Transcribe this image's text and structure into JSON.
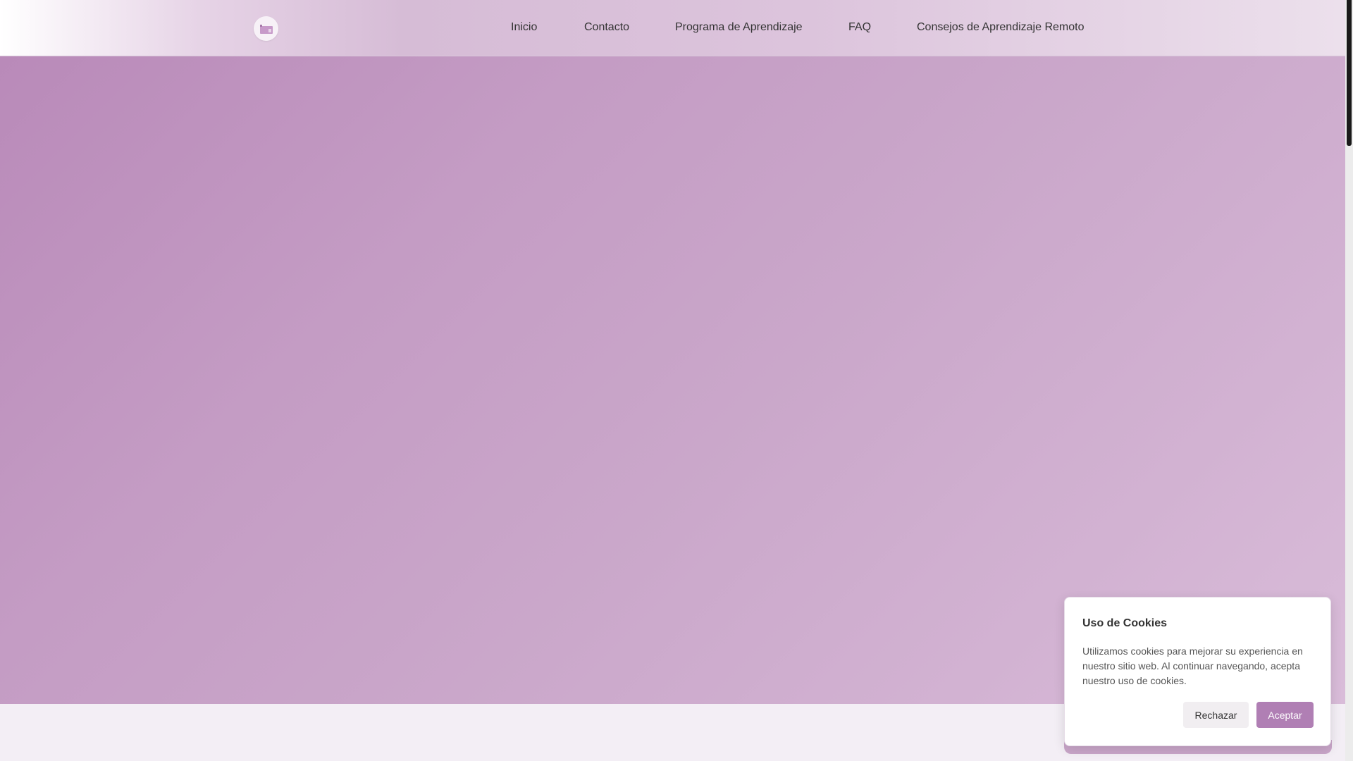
{
  "header": {
    "logo_icon": "school-icon",
    "nav": [
      {
        "label": "Inicio"
      },
      {
        "label": "Contacto"
      },
      {
        "label": "Programa de Aprendizaje"
      },
      {
        "label": "FAQ"
      },
      {
        "label": "Consejos de Aprendizaje Remoto"
      }
    ]
  },
  "cookie_banner": {
    "title": "Uso de Cookies",
    "message": "Utilizamos cookies para mejorar su experiencia en nuestro sitio web. Al continuar navegando, acepta nuestro uso de cookies.",
    "reject_label": "Rechazar",
    "accept_label": "Aceptar"
  },
  "colors": {
    "accent": "#b07fb4",
    "hero_start": "#b98ab9",
    "hero_end": "#d9bcd9"
  }
}
